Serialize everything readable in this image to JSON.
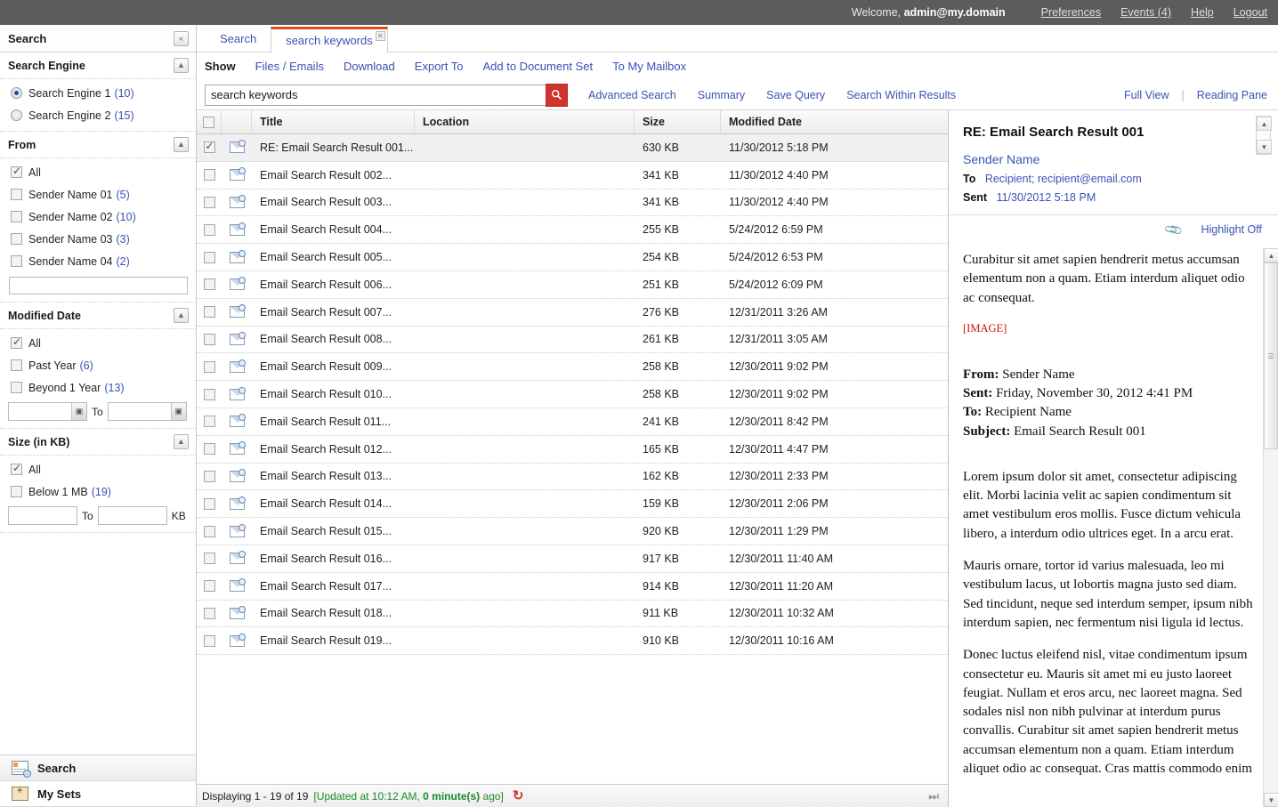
{
  "topbar": {
    "welcome_prefix": "Welcome,",
    "user": "admin@my.domain",
    "links": [
      "Preferences",
      "Events (4)",
      "Help",
      "Logout"
    ]
  },
  "sidebar": {
    "title": "Search",
    "collapse_icon": "«",
    "collapse_label": "collapse-sidebar",
    "sections": [
      {
        "title": "Search Engine",
        "collapse_icon": "▲",
        "type": "radio",
        "options": [
          {
            "label": "Search Engine 1",
            "count": "(10)",
            "checked": true
          },
          {
            "label": "Search Engine 2",
            "count": "(15)",
            "checked": false
          }
        ]
      },
      {
        "title": "From",
        "collapse_icon": "▲",
        "type": "checkbox",
        "options": [
          {
            "label": "All",
            "count": "",
            "checked": true
          },
          {
            "label": "Sender Name 01",
            "count": "(5)",
            "checked": false
          },
          {
            "label": "Sender Name 02",
            "count": "(10)",
            "checked": false
          },
          {
            "label": "Sender Name 03",
            "count": "(3)",
            "checked": false
          },
          {
            "label": "Sender Name 04",
            "count": "(2)",
            "checked": false
          }
        ],
        "free_text_value": "",
        "free_text_placeholder": ""
      },
      {
        "title": "Modified Date",
        "collapse_icon": "▲",
        "type": "checkbox",
        "options": [
          {
            "label": "All",
            "count": "",
            "checked": true
          },
          {
            "label": "Past Year",
            "count": "(6)",
            "checked": false
          },
          {
            "label": "Beyond 1 Year",
            "count": "(13)",
            "checked": false
          }
        ],
        "range": {
          "from_value": "",
          "to_label": "To",
          "to_value": "",
          "unit": ""
        }
      },
      {
        "title": "Size (in KB)",
        "collapse_icon": "▲",
        "type": "checkbox",
        "options": [
          {
            "label": "All",
            "count": "",
            "checked": true
          },
          {
            "label": "Below 1 MB",
            "count": "(19)",
            "checked": false
          }
        ],
        "range": {
          "from_value": "",
          "to_label": "To",
          "to_value": "",
          "unit": "KB"
        }
      }
    ],
    "nav": [
      {
        "label": "Search",
        "icon": "search-doc-icon"
      },
      {
        "label": "My Sets",
        "icon": "my-sets-icon"
      }
    ]
  },
  "tabs": [
    {
      "label": "Search",
      "active": false,
      "closable": false
    },
    {
      "label": "search keywords",
      "active": true,
      "closable": true,
      "close_icon": "✕"
    }
  ],
  "toolbar": {
    "show_label": "Show",
    "links": [
      "Files / Emails",
      "Download",
      "Export To",
      "Add to Document Set",
      "To My Mailbox"
    ]
  },
  "search": {
    "value": "search keywords",
    "placeholder": "search keywords",
    "button_icon": "search-icon",
    "links": [
      "Advanced Search",
      "Summary",
      "Save Query",
      "Search Within Results"
    ],
    "view_links": [
      "Full View",
      "Reading Pane"
    ],
    "separator": "|"
  },
  "grid": {
    "columns": [
      "",
      "",
      "Title",
      "Location",
      "Size",
      "Modified Date"
    ],
    "select_all_checked": false,
    "rows": [
      {
        "checked": true,
        "title": "RE: Email Search Result 001...",
        "location": "",
        "size": "630 KB",
        "date": "11/30/2012 5:18 PM"
      },
      {
        "checked": false,
        "title": "Email Search Result 002...",
        "location": "",
        "size": "341 KB",
        "date": "11/30/2012 4:40 PM"
      },
      {
        "checked": false,
        "title": "Email Search Result 003...",
        "location": "",
        "size": "341 KB",
        "date": "11/30/2012 4:40 PM"
      },
      {
        "checked": false,
        "title": "Email Search Result 004...",
        "location": "",
        "size": "255 KB",
        "date": "5/24/2012 6:59 PM"
      },
      {
        "checked": false,
        "title": "Email Search Result 005...",
        "location": "",
        "size": "254 KB",
        "date": "5/24/2012 6:53 PM"
      },
      {
        "checked": false,
        "title": "Email Search Result 006...",
        "location": "",
        "size": "251 KB",
        "date": "5/24/2012 6:09 PM"
      },
      {
        "checked": false,
        "title": "Email Search Result 007...",
        "location": "",
        "size": "276 KB",
        "date": "12/31/2011 3:26 AM"
      },
      {
        "checked": false,
        "title": "Email Search Result 008...",
        "location": "",
        "size": "261 KB",
        "date": "12/31/2011 3:05 AM"
      },
      {
        "checked": false,
        "title": "Email Search Result 009...",
        "location": "",
        "size": "258 KB",
        "date": "12/30/2011 9:02 PM"
      },
      {
        "checked": false,
        "title": "Email Search Result 010...",
        "location": "",
        "size": "258 KB",
        "date": "12/30/2011 9:02 PM"
      },
      {
        "checked": false,
        "title": "Email Search Result 011...",
        "location": "",
        "size": "241 KB",
        "date": "12/30/2011 8:42 PM"
      },
      {
        "checked": false,
        "title": "Email Search Result 012...",
        "location": "",
        "size": "165 KB",
        "date": "12/30/2011 4:47 PM"
      },
      {
        "checked": false,
        "title": "Email Search Result 013...",
        "location": "",
        "size": "162 KB",
        "date": "12/30/2011 2:33 PM"
      },
      {
        "checked": false,
        "title": "Email Search Result 014...",
        "location": "",
        "size": "159 KB",
        "date": "12/30/2011 2:06 PM"
      },
      {
        "checked": false,
        "title": "Email Search Result 015...",
        "location": "",
        "size": "920 KB",
        "date": "12/30/2011 1:29 PM"
      },
      {
        "checked": false,
        "title": "Email Search Result 016...",
        "location": "",
        "size": "917 KB",
        "date": "12/30/2011 11:40 AM"
      },
      {
        "checked": false,
        "title": "Email Search Result 017...",
        "location": "",
        "size": "914 KB",
        "date": "12/30/2011 11:20 AM"
      },
      {
        "checked": false,
        "title": "Email Search Result 018...",
        "location": "",
        "size": "911 KB",
        "date": "12/30/2011 10:32 AM"
      },
      {
        "checked": false,
        "title": "Email Search Result 019...",
        "location": "",
        "size": "910 KB",
        "date": "12/30/2011 10:16 AM"
      }
    ]
  },
  "status": {
    "displaying": "Displaying 1 - 19 of 19",
    "updated_prefix": "[Updated at 10:12 AM,",
    "updated_bold": "0 minute(s)",
    "updated_suffix": "ago]",
    "refresh_icon": "↻",
    "pager_icon": "⏭"
  },
  "reading_pane": {
    "subject": "RE: Email Search Result 001",
    "sender": "Sender Name",
    "to_label": "To",
    "to_value": "Recipient; recipient@email.com",
    "sent_label": "Sent",
    "sent_value": "11/30/2012 5:18 PM",
    "attachment_icon": "paperclip-icon",
    "highlight_link": "Highlight Off",
    "body": {
      "intro": "Curabitur sit amet sapien hendrerit metus accumsan elementum non a quam. Etiam interdum aliquet odio ac consequat.",
      "image_placeholder": "[IMAGE]",
      "header_from_label": "From:",
      "header_from_value": "Sender Name",
      "header_sent_label": "Sent:",
      "header_sent_value": "Friday, November 30, 2012 4:41 PM",
      "header_to_label": "To:",
      "header_to_value": "Recipient Name",
      "header_subject_label": "Subject:",
      "header_subject_value": "Email Search Result 001",
      "para1": "Lorem ipsum dolor sit amet, consectetur adipiscing elit. Morbi lacinia velit ac sapien condimentum sit amet vestibulum eros mollis. Fusce dictum vehicula libero, a interdum odio ultrices eget. In a arcu erat.",
      "para2": "Mauris ornare, tortor id varius malesuada, leo mi vestibulum lacus, ut lobortis magna justo sed diam. Sed tincidunt, neque sed interdum semper, ipsum nibh interdum sapien, nec fermentum nisi ligula id lectus.",
      "para3": "Donec luctus eleifend nisl, vitae condimentum ipsum consectetur eu. Mauris sit amet mi eu justo laoreet feugiat. Nullam et eros arcu, nec laoreet magna. Sed sodales nisl non nibh pulvinar at interdum purus convallis. Curabitur sit amet sapien hendrerit metus accumsan elementum non a quam. Etiam interdum aliquet odio ac consequat. Cras mattis commodo enim"
    }
  },
  "colors": {
    "accent_red": "#d0342c",
    "tab_active_top": "#e8491c",
    "link_blue": "#3a52b5",
    "topbar_gray": "#5c5c5c",
    "status_green": "#1d8a2a"
  }
}
